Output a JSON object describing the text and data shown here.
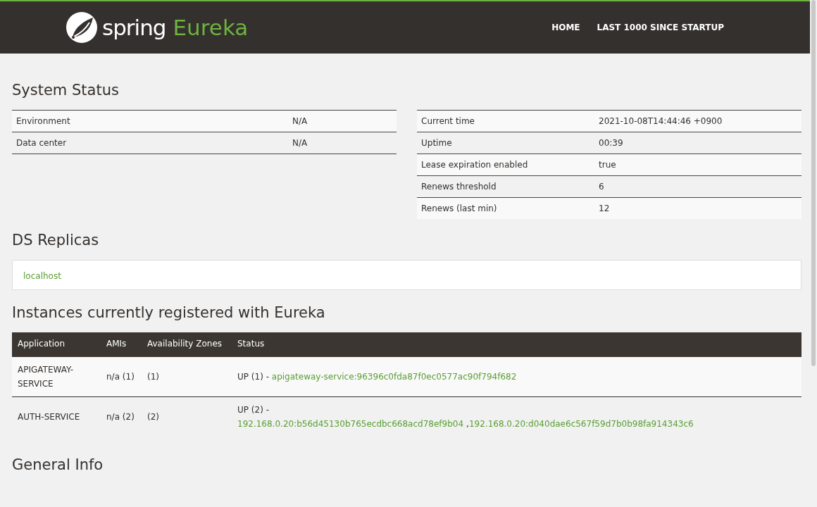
{
  "header": {
    "brand": "spring",
    "product": "Eureka",
    "nav": [
      "HOME",
      "LAST 1000 SINCE STARTUP"
    ]
  },
  "system_status": {
    "title": "System Status",
    "left": [
      {
        "label": "Environment",
        "value": "N/A"
      },
      {
        "label": "Data center",
        "value": "N/A"
      }
    ],
    "right": [
      {
        "label": "Current time",
        "value": "2021-10-08T14:44:46 +0900"
      },
      {
        "label": "Uptime",
        "value": "00:39"
      },
      {
        "label": "Lease expiration enabled",
        "value": "true"
      },
      {
        "label": "Renews threshold",
        "value": "6"
      },
      {
        "label": "Renews (last min)",
        "value": "12"
      }
    ]
  },
  "ds_replicas": {
    "title": "DS Replicas",
    "items": [
      "localhost"
    ]
  },
  "instances": {
    "title": "Instances currently registered with Eureka",
    "columns": [
      "Application",
      "AMIs",
      "Availability Zones",
      "Status"
    ],
    "rows": [
      {
        "application": "APIGATEWAY-SERVICE",
        "amis": "n/a (1)",
        "zones": "(1)",
        "status": "UP (1) -",
        "links": [
          "apigateway-service:96396c0fda87f0ec0577ac90f794f682"
        ]
      },
      {
        "application": "AUTH-SERVICE",
        "amis": "n/a (2)",
        "zones": "(2)",
        "status": "UP (2) -",
        "links": [
          "192.168.0.20:b56d45130b765ecdbc668acd78ef9b04",
          "192.168.0.20:d040dae6c567f59d7b0b98fa914343c6"
        ],
        "separator": ","
      }
    ]
  },
  "general_info": {
    "title": "General Info"
  }
}
